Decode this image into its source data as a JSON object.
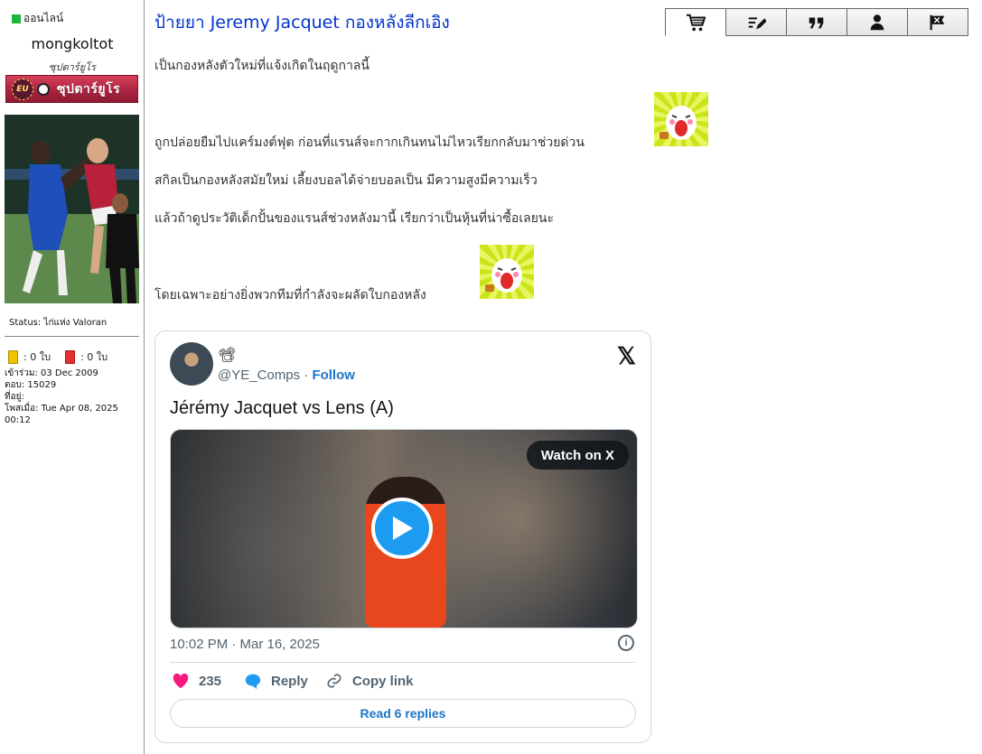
{
  "profile": {
    "online_label": "ออนไลน์",
    "username": "mongkoltot",
    "user_title": "ซุปตาร์ยูโร",
    "rank_badge_text": "ซุปตาร์ยูโร",
    "rank_badge_emblem": "EU",
    "status": "Status: ไก่แห่ง Valoran",
    "yellow_cards": ": 0 ใบ",
    "red_cards": ": 0 ใบ",
    "joined": "เข้าร่วม: 03 Dec 2009",
    "replies": "ตอบ: 15029",
    "location": "ที่อยู่:",
    "posted": "โพสเมื่อ: Tue Apr 08, 2025 00:12",
    "online_color": "#1db53a"
  },
  "post": {
    "title": "ป้ายยา Jeremy Jacquet กองหลังลีกเอิง",
    "lines": [
      "เป็นกองหลังตัวใหม่ที่แจ้งเกิดในฤดูกาลนี้",
      "ถูกปล่อยยืมไปแคร์มงต์ฟุต ก่อนที่แรนส์จะกากเกินทนไม่ไหวเรียกกลับมาช่วยด่วน",
      "สกิลเป็นกองหลังสมัยใหม่ เลี้ยงบอลได้จ่ายบอลเป็น มีความสูงมีความเร็ว",
      "แล้วถ้าดูประวัติเด็กปั้นของแรนส์ช่วงหลังมานี้ เรียกว่าเป็นหุ้นที่น่าซื้อเลยนะ",
      "โดยเฉพาะอย่างยิ่งพวกทีมที่กำลังจะผลัดใบกองหลัง"
    ],
    "toolbar": [
      "cart-icon",
      "edit-icon",
      "quote-icon",
      "profile-icon",
      "report-icon"
    ],
    "title_color": "#0033cc"
  },
  "tweet": {
    "camera_emoji": "📽",
    "handle": "@YE_Comps",
    "separator": " · ",
    "follow_label": "Follow",
    "x_logo": "𝕏",
    "text": "Jérémy Jacquet vs Lens (A)",
    "watch_label": "Watch on X",
    "timestamp": "10:02 PM · Mar 16, 2025",
    "info_glyph": "i",
    "likes": "235",
    "reply_label": "Reply",
    "copy_link_label": "Copy link",
    "read_replies_label": "Read 6 replies",
    "accent_color": "#1d9bf0",
    "like_color": "#f91880"
  }
}
